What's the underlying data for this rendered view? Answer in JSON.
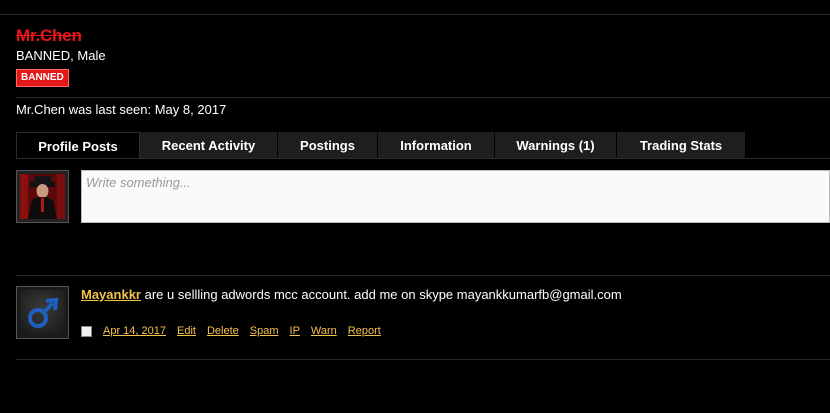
{
  "profile": {
    "username": "Mr.Chen",
    "user_title": "BANNED, Male",
    "badge": "BANNED",
    "last_seen": "Mr.Chen was last seen: May 8, 2017"
  },
  "tabs": [
    {
      "label": "Profile Posts",
      "active": true
    },
    {
      "label": "Recent Activity",
      "active": false
    },
    {
      "label": "Postings",
      "active": false
    },
    {
      "label": "Information",
      "active": false
    },
    {
      "label": "Warnings (1)",
      "active": false
    },
    {
      "label": "Trading Stats",
      "active": false
    }
  ],
  "composer": {
    "placeholder": "Write something..."
  },
  "post": {
    "author": "Mayankkr",
    "message": "are u sellling adwords mcc account. add me on skype mayankkumarfb@gmail.com",
    "date": "Apr 14, 2017",
    "actions": [
      "Edit",
      "Delete",
      "Spam",
      "IP",
      "Warn",
      "Report"
    ],
    "avatar_icon": "male-symbol-icon"
  },
  "colors": {
    "username": "#e8151b",
    "badge_bg": "#e3161a",
    "link": "#f4c24b",
    "tab_bg": "#1e1e1e",
    "male_icon": "#1f5fbf"
  }
}
